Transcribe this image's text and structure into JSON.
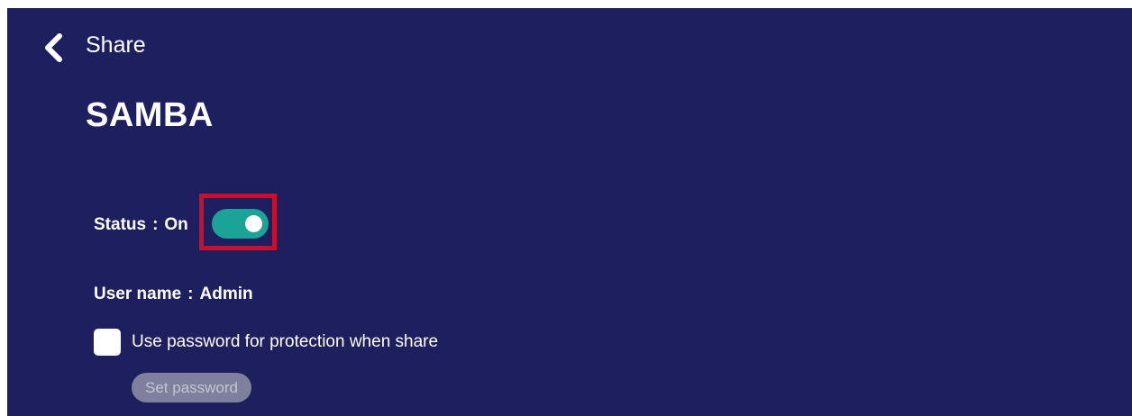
{
  "header": {
    "back_icon": "chevron-left-icon",
    "title": "Share"
  },
  "page": {
    "title": "SAMBA"
  },
  "status": {
    "label": "Status",
    "separator": ":",
    "value": "On",
    "toggle_on": true,
    "toggle_color": "#1aa396",
    "highlight_color": "#c8102e"
  },
  "user": {
    "label": "User name",
    "separator": ":",
    "value": "Admin"
  },
  "password_protection": {
    "checked": false,
    "label": "Use password for protection when share"
  },
  "set_password_button": {
    "label": "Set password",
    "enabled": false
  },
  "colors": {
    "background": "#1d1f5f",
    "text": "#ffffff"
  }
}
